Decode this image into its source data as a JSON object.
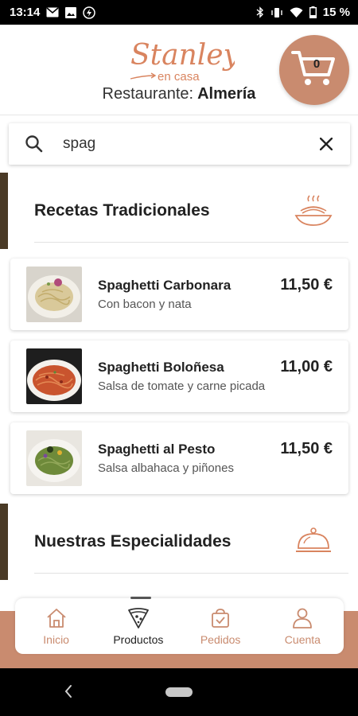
{
  "status_bar": {
    "time": "13:14",
    "left_icons": [
      "mail-icon",
      "image-icon",
      "bolt-icon"
    ],
    "right_icons": [
      "bluetooth-icon",
      "vibrate-icon",
      "wifi-icon",
      "battery-icon"
    ],
    "battery": "15 %"
  },
  "header": {
    "logo_script": "Stanley",
    "logo_sub": "en casa",
    "restaurant_label": "Restaurante:",
    "restaurant_value": "Almería",
    "cart_count": "0"
  },
  "search": {
    "value": "spag"
  },
  "categories": [
    {
      "title": "Recetas Tradicionales",
      "icon": "pasta-bowl-icon"
    },
    {
      "title": "Nuestras Especialidades",
      "icon": "cloche-icon"
    }
  ],
  "products": [
    {
      "name": "Spaghetti Carbonara",
      "description": "Con bacon y nata",
      "price": "11,50 €",
      "image": "carbonara-photo"
    },
    {
      "name": "Spaghetti Boloñesa",
      "description": "Salsa de tomate y carne picada",
      "price": "11,00 €",
      "image": "bolognese-photo"
    },
    {
      "name": "Spaghetti al Pesto",
      "description": "Salsa albahaca y piñones",
      "price": "11,50 €",
      "image": "pesto-photo"
    }
  ],
  "bottom_nav": {
    "items": [
      {
        "label": "Inicio",
        "icon": "home-icon",
        "active": false
      },
      {
        "label": "Productos",
        "icon": "pizza-slice-icon",
        "active": true
      },
      {
        "label": "Pedidos",
        "icon": "bag-check-icon",
        "active": false
      },
      {
        "label": "Cuenta",
        "icon": "user-icon",
        "active": false
      }
    ]
  },
  "colors": {
    "accent": "#c98b6f",
    "category_marker": "#4a3a26",
    "text_dark": "#222222"
  }
}
